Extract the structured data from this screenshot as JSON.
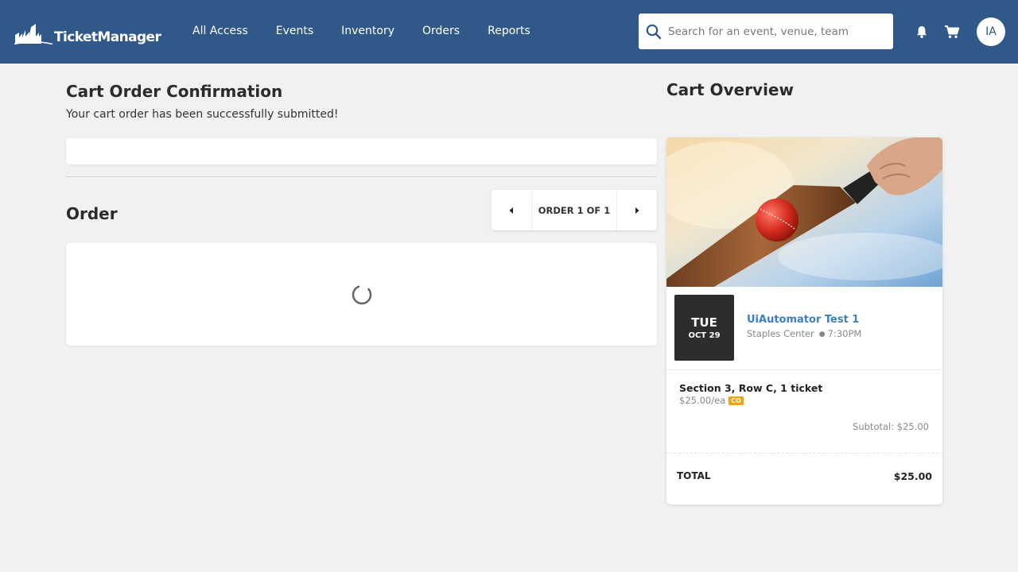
{
  "header": {
    "logo_text": "TicketManager",
    "nav": [
      "All Access",
      "Events",
      "Inventory",
      "Orders",
      "Reports"
    ],
    "search_placeholder": "Search for an event, venue, team",
    "avatar_initials": "IA",
    "background_color": "#305888"
  },
  "confirmation": {
    "title": "Cart Order Confirmation",
    "message": "Your cart order has been successfully submitted!"
  },
  "order": {
    "title": "Order",
    "pager_label": "ORDER 1 OF 1"
  },
  "cart_overview": {
    "title": "Cart Overview",
    "event": {
      "day_of_week": "TUE",
      "month_day": "OCT 29",
      "name": "UiAutomator Test 1",
      "venue": "Staples Center",
      "time": "7:30PM"
    },
    "line_item": {
      "description": "Section 3, Row C, 1 ticket",
      "price_each": "$25.00/ea",
      "badge": "CO",
      "subtotal": "Subtotal: $25.00"
    },
    "total_label": "TOTAL",
    "total_value": "$25.00"
  },
  "icons": {
    "search": "search-icon",
    "bell": "bell-icon",
    "cart": "cart-icon",
    "prev": "caret-left-icon",
    "next": "caret-right-icon",
    "loading": "loading-spinner-icon"
  },
  "colors": {
    "link": "#3c7fc0",
    "badge": "#f0a30a",
    "date_box": "#2d2d2d"
  }
}
